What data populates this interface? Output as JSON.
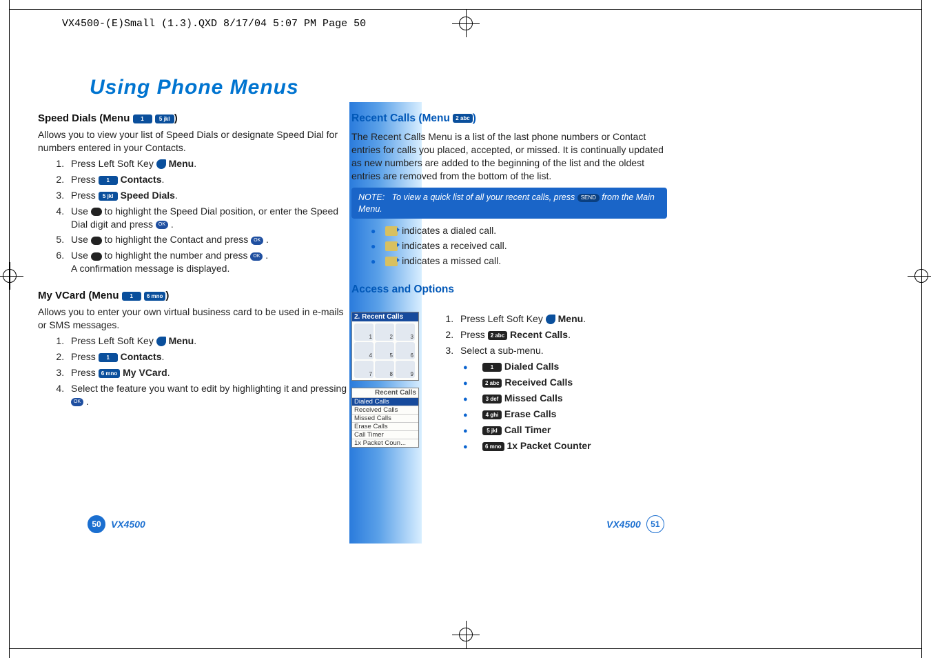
{
  "slug": "VX4500-(E)Small (1.3).QXD  8/17/04  5:07 PM  Page 50",
  "page_title": "Using Phone Menus",
  "left": {
    "speed_dials_head": "Speed Dials (Menu ",
    "speed_dials_tail": ")",
    "speed_dials_body": "Allows you to view your list of Speed Dials or designate Speed Dial for numbers entered in your Contacts.",
    "steps_sd": {
      "s1a": "Press Left Soft Key ",
      "s1b": " Menu",
      "s2a": "Press ",
      "s2b": " Contacts",
      "s3a": "Press ",
      "s3b": " Speed Dials",
      "s4a": "Use ",
      "s4b": " to highlight the Speed Dial position, or enter the Speed Dial digit and press ",
      "s5a": "Use ",
      "s5b": " to highlight the Contact and press ",
      "s6a": "Use ",
      "s6b": " to highlight the number and press ",
      "s6c": "A confirmation message is displayed."
    },
    "vcard_head": "My VCard (Menu ",
    "vcard_tail": ")",
    "vcard_body": "Allows you to enter your own virtual business card to be used in e-mails or SMS messages.",
    "steps_vc": {
      "s1a": "Press Left Soft Key ",
      "s1b": " Menu",
      "s2a": "Press ",
      "s2b": " Contacts",
      "s3a": "Press ",
      "s3b": " My VCard",
      "s4a": "Select the feature you want to edit by highlighting it and pressing "
    }
  },
  "right": {
    "recent_head": "Recent Calls (Menu ",
    "recent_tail": ")",
    "recent_body": "The Recent Calls Menu is a list of the last phone numbers or Contact entries for calls you placed, accepted, or missed. It is continually updated as new numbers are added to the beginning of the list and the oldest entries are removed from the bottom of the list.",
    "note_label": "NOTE:",
    "note_text1": "To view a quick list of all your recent calls, press ",
    "note_send": "SEND",
    "note_text2": " from the Main Menu.",
    "legend": {
      "dialed": " indicates a dialed call.",
      "received": " indicates a received call.",
      "missed": " indicates a missed call."
    },
    "access_head": "Access and Options",
    "steps": {
      "s1a": "Press Left Soft Key ",
      "s1b": " Menu",
      "s2a": "Press ",
      "s2b": " Recent Calls",
      "s3": "Select a sub-menu."
    },
    "submenu": {
      "i1": " Dialed Calls",
      "i2": " Received Calls",
      "i3": " Missed Calls",
      "i4": " Erase Calls",
      "i5": " Call Timer",
      "i6": " 1x Packet Counter"
    },
    "screen1_title": "2. Recent Calls",
    "screen2_title": "Recent Calls",
    "screen2_items": [
      "Dialed Calls",
      "Received Calls",
      "Missed Calls",
      "Erase Calls",
      "Call Timer",
      "1x Packet Coun..."
    ]
  },
  "keys": {
    "one": "1",
    "two": "2 abc",
    "three": "3 def",
    "four": "4 ghi",
    "five": "5 jkl",
    "six": "6 mno",
    "ok": "OK"
  },
  "footer": {
    "page_left": "50",
    "page_right": "51",
    "model": "VX4500"
  }
}
